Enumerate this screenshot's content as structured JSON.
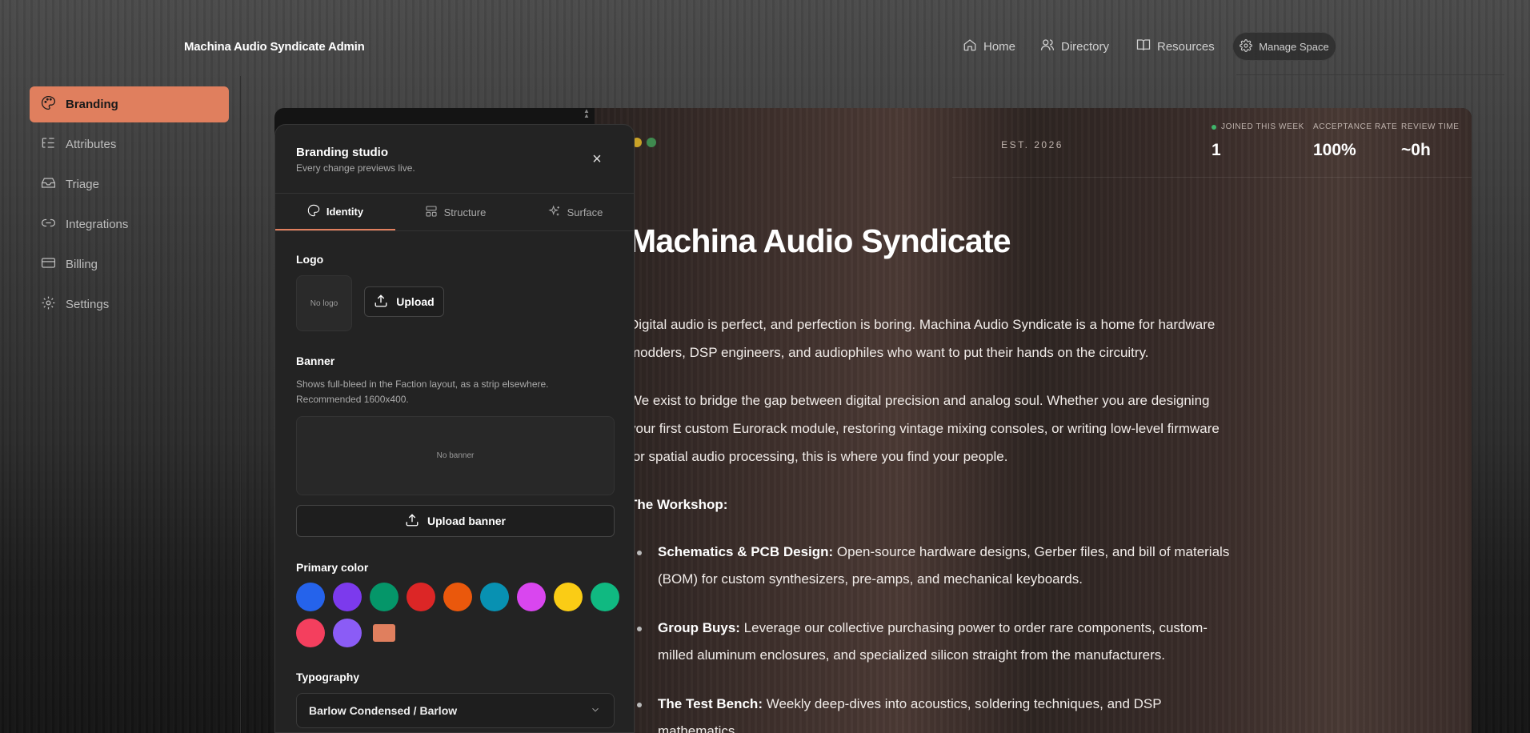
{
  "header": {
    "app_title": "Machina Audio Syndicate Admin",
    "nav": [
      {
        "label": "Home",
        "icon": "home-icon"
      },
      {
        "label": "Directory",
        "icon": "users-icon"
      },
      {
        "label": "Resources",
        "icon": "book-icon"
      }
    ],
    "manage_label": "Manage Space"
  },
  "sidebar": {
    "items": [
      {
        "label": "Branding",
        "icon": "palette-icon",
        "active": true
      },
      {
        "label": "Attributes",
        "icon": "list-tree-icon"
      },
      {
        "label": "Triage",
        "icon": "inbox-icon"
      },
      {
        "label": "Integrations",
        "icon": "link-icon"
      },
      {
        "label": "Billing",
        "icon": "credit-card-icon"
      },
      {
        "label": "Settings",
        "icon": "gear-icon"
      }
    ]
  },
  "panel": {
    "title": "Branding studio",
    "subtitle": "Every change previews live.",
    "close_label": "×",
    "tabs": [
      {
        "label": "Identity",
        "icon": "palette-icon",
        "active": true
      },
      {
        "label": "Structure",
        "icon": "layout-icon"
      },
      {
        "label": "Surface",
        "icon": "sparkles-icon"
      }
    ],
    "logo": {
      "label": "Logo",
      "placeholder": "No logo",
      "upload_label": "Upload"
    },
    "banner": {
      "label": "Banner",
      "hint": "Shows full-bleed in the Faction layout, as a strip elsewhere. Recommended 1600x400.",
      "placeholder": "No banner",
      "upload_label": "Upload banner"
    },
    "primary_color": {
      "label": "Primary color",
      "swatches": [
        "#2563eb",
        "#7c3aed",
        "#059669",
        "#dc2626",
        "#ea580c",
        "#0891b2",
        "#d946ef",
        "#facc15",
        "#10b981",
        "#f43f5e",
        "#8b5cf6"
      ],
      "custom": "#e07f5e"
    },
    "typography": {
      "label": "Typography",
      "value": "Barlow Condensed / Barlow"
    }
  },
  "preview": {
    "dot_colors": [
      "#c9a227",
      "#3f8a4f"
    ],
    "est": "EST. 2026",
    "stats": [
      {
        "label": "JOINED THIS WEEK",
        "value": "1",
        "indicator": "#3fb56b"
      },
      {
        "label": "ACCEPTANCE RATE",
        "value": "100%"
      },
      {
        "label": "REVIEW TIME",
        "value": "~0h"
      }
    ],
    "headline": "Machina Audio Syndicate",
    "paragraphs": [
      "Digital audio is perfect, and perfection is boring. Machina Audio Syndicate is a home for hardware modders, DSP engineers, and audiophiles who want to put their hands on the circuitry.",
      "We exist to bridge the gap between digital precision and analog soul. Whether you are designing your first custom Eurorack module, restoring vintage mixing consoles, or writing low-level firmware for spatial audio processing, this is where you find your people.",
      "The Workshop:"
    ],
    "bullets": [
      {
        "title": "Schematics & PCB Design:",
        "text": " Open-source hardware designs, Gerber files, and bill of materials (BOM) for custom synthesizers, pre-amps, and mechanical keyboards."
      },
      {
        "title": "Group Buys:",
        "text": " Leverage our collective purchasing power to order rare components, custom-milled aluminum enclosures, and specialized silicon straight from the manufacturers."
      },
      {
        "title": "The Test Bench:",
        "text": " Weekly deep-dives into acoustics, soldering techniques, and DSP mathematics."
      }
    ]
  }
}
